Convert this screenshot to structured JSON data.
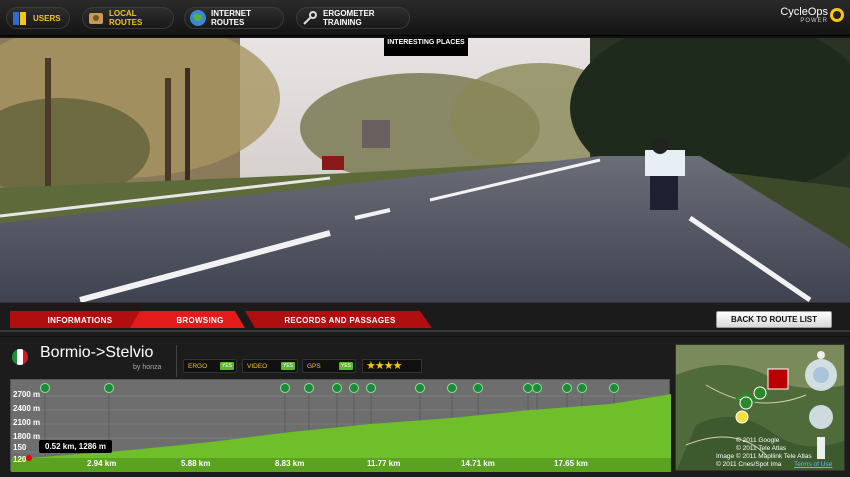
{
  "nav": [
    {
      "label": "USERS",
      "icon": "users-icon",
      "selected": true
    },
    {
      "label": "LOCAL ROUTES",
      "icon": "local-routes-icon",
      "selected": true
    },
    {
      "label": "INTERNET ROUTES",
      "icon": "globe-icon",
      "selected": false
    },
    {
      "label": "ERGOMETER TRAINING",
      "icon": "wrench-icon",
      "selected": false
    }
  ],
  "logo": {
    "brand": "CycleOps",
    "sub": "POWER"
  },
  "video": {
    "poi_label": "INTERESTING PLACES"
  },
  "tabs": [
    {
      "label": "INFORMATIONS",
      "active": false
    },
    {
      "label": "BROWSING",
      "active": true
    },
    {
      "label": "RECORDS AND PASSAGES",
      "active": false
    }
  ],
  "back_button": "BACK TO ROUTE LIST",
  "route": {
    "name": "Bormio->Stelvio",
    "author": "by honza",
    "country_flag": "italy-flag-icon",
    "tags": [
      {
        "label": "ERGO",
        "value": "YES"
      },
      {
        "label": "VIDEO",
        "value": "YES"
      },
      {
        "label": "GPS",
        "value": "YES"
      }
    ],
    "rating_stars": 4,
    "rating_text": "★★★★"
  },
  "profile": {
    "y_ticks": [
      "2700 m",
      "2400 m",
      "2100 m",
      "1800 m",
      "150",
      "120"
    ],
    "x_ticks": [
      "2.94 km",
      "5.88 km",
      "8.83 km",
      "11.77 km",
      "14.71 km",
      "17.65 km"
    ],
    "tooltip": "0.52 km, 1286 m",
    "colors": {
      "fill": "#6fbf2a",
      "bg": "#6e6e6e"
    }
  },
  "map": {
    "copyright": [
      "© 2011 Google",
      "© 2011 Tele Atlas",
      "Image © 2011 Mapllink Tele Atlas",
      "© 2011 Cnes/Spot Ima"
    ],
    "terms": "Terms of Use"
  },
  "colors": {
    "accent": "#f5c518",
    "tab_red": "#cc1111",
    "active_tab": "#e31b1b"
  }
}
